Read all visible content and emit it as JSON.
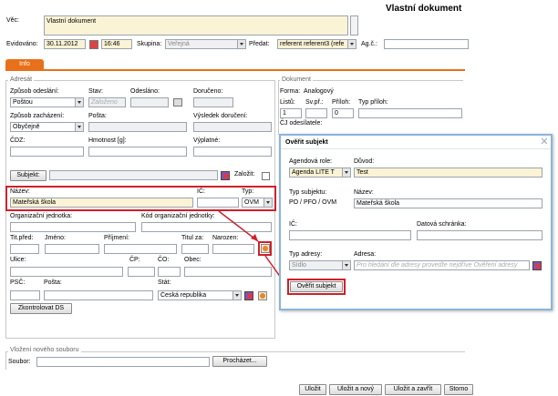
{
  "header": {
    "title": "Vlastní dokument"
  },
  "vec": {
    "label": "Věc:",
    "value": "Vlastní dokument"
  },
  "evidence": {
    "evidovano_label": "Evidováno:",
    "date": "30.11.2012",
    "time": "16:46",
    "skupina_label": "Skupina:",
    "skupina_value": "Veřejná",
    "predat_label": "Předat:",
    "predat_value": "referent referent3 (refe",
    "agc_label": "Ag.č.:"
  },
  "tab": {
    "label": "Info"
  },
  "adresat": {
    "title": "Adresát",
    "zpusob_odeslani_label": "Způsob odeslání:",
    "zpusob_odeslani_value": "Poštou",
    "stav_label": "Stav:",
    "stav_value": "Založeno",
    "odeslano_label": "Odesláno:",
    "doruceno_label": "Doručeno:",
    "zpusob_zachazeni_label": "Způsob zacházení:",
    "zpusob_zachazeni_value": "Obyčejně",
    "posta_label": "Pošta:",
    "vysledek_label": "Výsledek doručení:",
    "cdz_label": "ČDZ:",
    "hmotnost_label": "Hmotnost [g]:",
    "vyplatne_label": "Výplatné:",
    "subjekt_button": "Subjekt:",
    "zalozit_label": "Založit:",
    "nazev_label": "Název:",
    "nazev_value": "Mateřská škola",
    "ic_label": "IČ:",
    "typ_label": "Typ:",
    "typ_value": "OVM",
    "org_jednotka_label": "Organizační jednotka:",
    "kod_org_label": "Kód organizační jednotky:",
    "tit_pred_label": "Tit.před:",
    "jmeno_label": "Jméno:",
    "prijmeni_label": "Příjmení:",
    "titul_za_label": "Titul za:",
    "narozen_label": "Narozen:",
    "ulice_label": "Ulice:",
    "cp_label": "ČP:",
    "co_label": "ČO:",
    "obec_label": "Obec:",
    "psc_label": "PSČ:",
    "posta2_label": "Pošta:",
    "stat_label": "Stát:",
    "stat_value": "Česká republika",
    "zkontrolovat_button": "Zkontrolovat DS"
  },
  "dokument": {
    "title": "Dokument",
    "forma_label": "Forma:",
    "forma_value": "Analogový",
    "listu_label": "Listů:",
    "sv_pr_label": "Sv.př.:",
    "priloh_label": "Příloh:",
    "typ_priloh_label": "Typ příloh:",
    "listu_value": "1",
    "priloh_value": "0",
    "cj_label": "ČJ odesílatele:"
  },
  "dialog": {
    "title": "Ověřit subjekt",
    "agendova_role_label": "Agendová role:",
    "agendova_role_value": "Agenda LITE T",
    "duvod_label": "Důvod:",
    "duvod_value": "Test",
    "typ_subjektu_label": "Typ subjektu:",
    "typ_subjektu_value": "PO / PFO / OVM",
    "nazev_label": "Název:",
    "nazev_value": "Mateřská škola",
    "ic_label": "IČ:",
    "datova_schranka_label": "Datová schránka:",
    "typ_adresy_label": "Typ adresy:",
    "typ_adresy_value": "Sídlo",
    "adresa_label": "Adresa:",
    "adresa_placeholder": "Pro hledání dle adresy proveďte nejdříve Ověření adresy",
    "overit_button": "Ověřit subjekt"
  },
  "vlozeni": {
    "title": "Vložení nového souboru",
    "soubor_label": "Soubor:",
    "prochazet_button": "Procházet..."
  },
  "footer": {
    "ulozit": "Uložit",
    "ulozit_novy": "Uložit a nový",
    "ulozit_zavrit": "Uložit a zavřít",
    "storno": "Storno"
  },
  "colors": {
    "tab_orange": "#e8701a",
    "highlight_red": "#d0202a",
    "field_yellow": "#fbf3d5",
    "dialog_border": "#8ab4dc"
  }
}
